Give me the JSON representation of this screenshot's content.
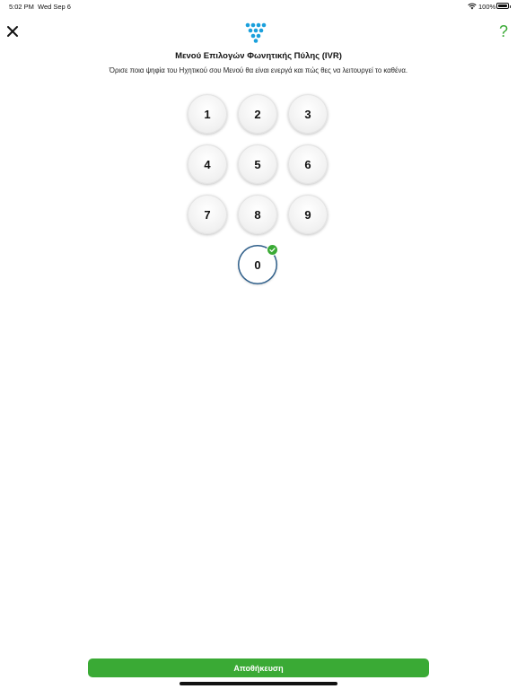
{
  "status_bar": {
    "time": "5:02 PM",
    "date": "Wed Sep 6",
    "battery": "100%",
    "wifi_icon": "wifi-icon",
    "battery_icon": "battery-icon"
  },
  "header": {
    "close_icon": "close-icon",
    "help_label": "?",
    "logo_icon": "keypad-logo-icon",
    "title": "Μενού Επιλογών Φωνητικής Πύλης (IVR)",
    "subtitle": "Όρισε ποια ψηφία του Ηχητικού σου Μενού θα είναι ενεργά και πώς θες να λειτουργεί το καθένα."
  },
  "keypad": {
    "keys": [
      "1",
      "2",
      "3",
      "4",
      "5",
      "6",
      "7",
      "8",
      "9",
      "0"
    ],
    "selected_key": "0"
  },
  "footer": {
    "save_label": "Αποθήκευση"
  },
  "colors": {
    "accent": "#3aaa35",
    "logo_blue": "#1aa0dc",
    "selected_ring": "#2f5f8a"
  }
}
